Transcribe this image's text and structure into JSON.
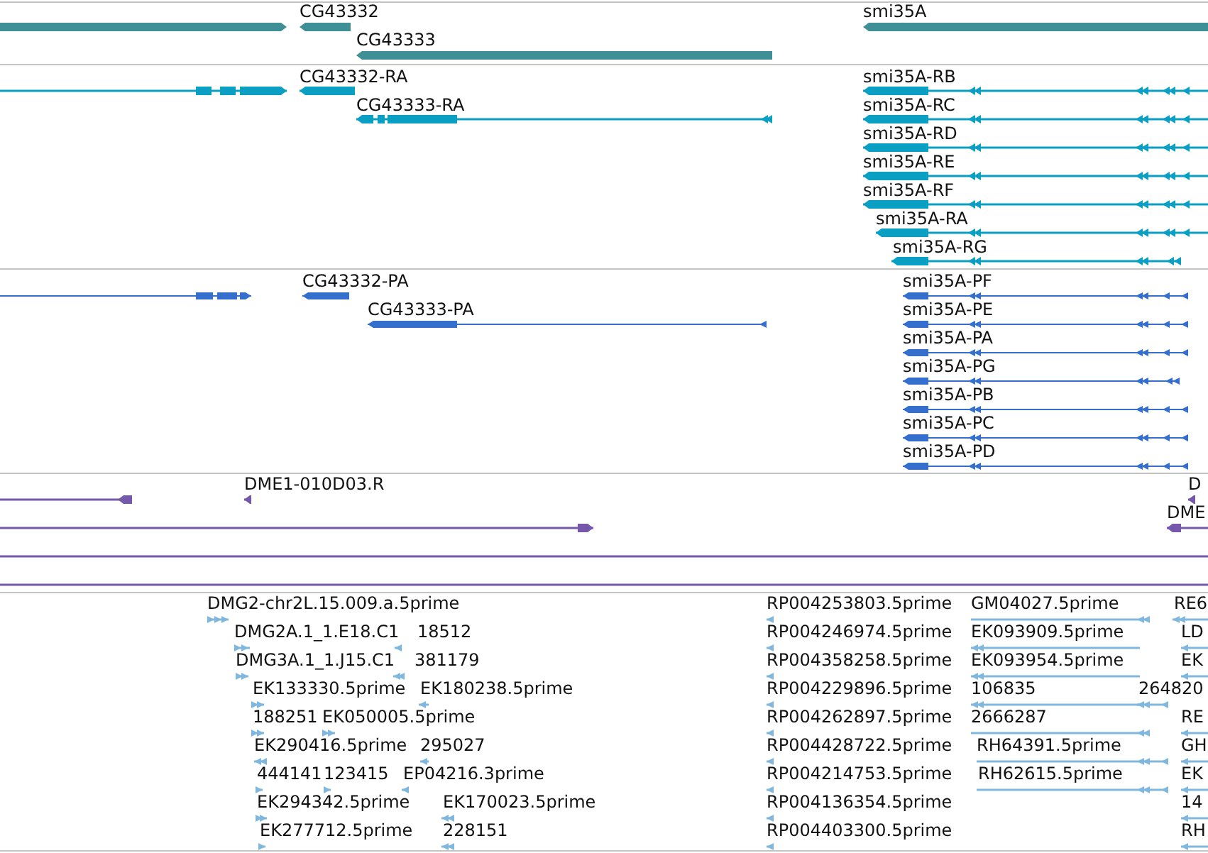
{
  "tracks": [
    {
      "kind": "gene",
      "features": [
        {
          "reverse": false
        },
        {
          "label": "CG43332",
          "reverse": true
        },
        {
          "label": "CG43333",
          "reverse": true
        },
        {
          "label": "smi35A",
          "reverse": true
        }
      ]
    },
    {
      "kind": "transcript",
      "features": [
        {
          "reverse": false
        },
        {
          "label": "CG43332-RA",
          "reverse": true
        },
        {
          "label": "CG43333-RA",
          "reverse": true
        },
        {
          "label": "smi35A-RB",
          "reverse": true
        },
        {
          "label": "smi35A-RC",
          "reverse": true
        },
        {
          "label": "smi35A-RD",
          "reverse": true
        },
        {
          "label": "smi35A-RE",
          "reverse": true
        },
        {
          "label": "smi35A-RF",
          "reverse": true
        },
        {
          "label": "smi35A-RA",
          "reverse": true
        },
        {
          "label": "smi35A-RG",
          "reverse": true
        }
      ]
    },
    {
      "kind": "protein",
      "features": [
        {
          "reverse": false
        },
        {
          "label": "CG43332-PA",
          "reverse": true
        },
        {
          "label": "CG43333-PA",
          "reverse": true
        },
        {
          "label": "smi35A-PF",
          "reverse": true
        },
        {
          "label": "smi35A-PE",
          "reverse": true
        },
        {
          "label": "smi35A-PA",
          "reverse": true
        },
        {
          "label": "smi35A-PG",
          "reverse": true
        },
        {
          "label": "smi35A-PB",
          "reverse": true
        },
        {
          "label": "smi35A-PC",
          "reverse": true
        },
        {
          "label": "smi35A-PD",
          "reverse": true
        }
      ]
    },
    {
      "kind": "clone",
      "features": [
        {
          "kind": "arrow",
          "reverse": true
        },
        {
          "kind": "arrow",
          "label": "DME1-010D03.R",
          "reverse": true
        },
        {
          "kind": "arrow",
          "label": "D",
          "reverse": true
        },
        {
          "kind": "arrow",
          "reverse": false
        },
        {
          "kind": "arrow",
          "label": "DME",
          "reverse": true
        },
        {
          "kind": "line"
        },
        {
          "kind": "line"
        }
      ]
    },
    {
      "kind": "est",
      "features": [
        {
          "label": "DMG2-chr2L.15.009.a.5prime",
          "reverse": false
        },
        {
          "label": "RP004253803.5prime",
          "reverse": true
        },
        {
          "label": "GM04027.5prime",
          "reverse": true
        },
        {
          "label": "RE6",
          "reverse": true
        },
        {
          "label": "DMG2A.1_1.E18.C1",
          "reverse": false
        },
        {
          "label": "18512",
          "reverse": true
        },
        {
          "label": "RP004246974.5prime",
          "reverse": true
        },
        {
          "label": "EK093909.5prime",
          "reverse": true
        },
        {
          "label": "LD",
          "reverse": true
        },
        {
          "label": "DMG3A.1_1.J15.C1",
          "reverse": false
        },
        {
          "label": "381179",
          "reverse": true
        },
        {
          "label": "RP004358258.5prime",
          "reverse": true
        },
        {
          "label": "EK093954.5prime",
          "reverse": true
        },
        {
          "label": "EK",
          "reverse": true
        },
        {
          "label": "EK133330.5prime",
          "reverse": false
        },
        {
          "label": "EK180238.5prime",
          "reverse": true
        },
        {
          "label": "RP004229896.5prime",
          "reverse": true
        },
        {
          "label": "106835",
          "reverse": true
        },
        {
          "label": "264820",
          "reverse": true
        },
        {
          "label": "188251",
          "reverse": false
        },
        {
          "label": "EK050005.5prime",
          "reverse": false
        },
        {
          "label": "RP004262897.5prime",
          "reverse": true
        },
        {
          "label": "2666287",
          "reverse": true
        },
        {
          "label": "RE",
          "reverse": true
        },
        {
          "label": "EK290416.5prime",
          "reverse": true
        },
        {
          "label": "295027",
          "reverse": true
        },
        {
          "label": "RP004428722.5prime",
          "reverse": true
        },
        {
          "label": "RH64391.5prime",
          "reverse": true
        },
        {
          "label": "GH",
          "reverse": true
        },
        {
          "label": "444141",
          "reverse": false
        },
        {
          "label": "123415",
          "reverse": false
        },
        {
          "label": "EP04216.3prime",
          "reverse": true
        },
        {
          "label": "RP004214753.5prime",
          "reverse": true
        },
        {
          "label": "RH62615.5prime",
          "reverse": true
        },
        {
          "label": "EK",
          "reverse": true
        },
        {
          "label": "EK294342.5prime",
          "reverse": false
        },
        {
          "label": "EK170023.5prime",
          "reverse": true
        },
        {
          "label": "RP004136354.5prime",
          "reverse": true
        },
        {
          "label": "14",
          "reverse": true
        },
        {
          "label": "EK277712.5prime",
          "reverse": false
        },
        {
          "label": "228151",
          "reverse": true
        },
        {
          "label": "RP004403300.5prime",
          "reverse": true
        },
        {
          "label": "RH",
          "reverse": true
        }
      ]
    }
  ]
}
